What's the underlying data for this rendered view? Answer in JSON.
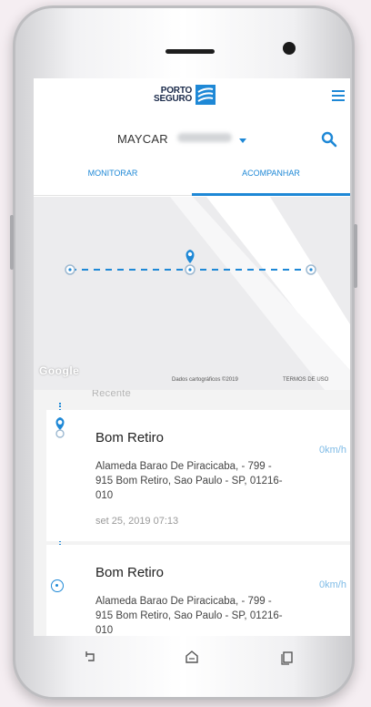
{
  "app": {
    "brand_line1": "PORTO",
    "brand_line2": "SEGURO",
    "accent": "#1e88d6"
  },
  "header": {
    "menu_icon": "hamburger-menu-icon",
    "search_icon": "search-icon"
  },
  "selector": {
    "vehicle_name": "MAYCAR"
  },
  "tabs": [
    {
      "label": "MONITORAR",
      "active": false
    },
    {
      "label": "ACOMPANHAR",
      "active": true
    }
  ],
  "map": {
    "watermark": "Google",
    "attribution": "Dados cartográficos ©2019",
    "terms": "TERMOS DE USO"
  },
  "list": {
    "sheet_label": "Recente",
    "items": [
      {
        "place": "Bom Retiro",
        "address": "Alameda Barao De Piracicaba, - 799 - 915 Bom Retiro, Sao Paulo - SP, 01216-010",
        "time": "set 25, 2019 07:13",
        "speed": "0km/h"
      },
      {
        "place": "Bom Retiro",
        "address": "Alameda Barao De Piracicaba, - 799 - 915 Bom Retiro, Sao Paulo - SP, 01216-010",
        "time": "",
        "speed": "0km/h"
      }
    ]
  },
  "navbar": {
    "icons": [
      "back-icon",
      "home-icon",
      "recent-apps-icon"
    ]
  }
}
